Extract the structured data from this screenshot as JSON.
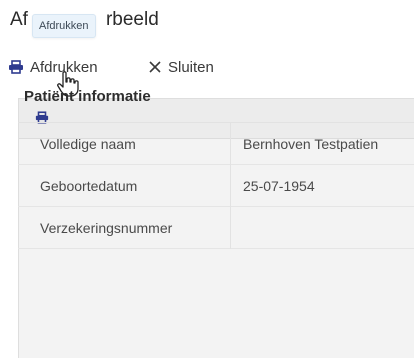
{
  "window": {
    "title_visible": "Af",
    "title_tail": "rbeeld"
  },
  "tooltip": {
    "text": "Afdrukken"
  },
  "toolbar": {
    "print_label": "Afdrukken",
    "print_icon": "printer-icon",
    "close_label": "Sluiten",
    "close_icon": "close-icon"
  },
  "panel": {
    "header_icon": "printer-icon",
    "section_title": "Patiënt informatie",
    "fields": [
      {
        "label": "Volledige naam",
        "value": "Bernhoven Testpatien"
      },
      {
        "label": "Geboortedatum",
        "value": "25-07-1954"
      },
      {
        "label": "Verzekeringsnummer",
        "value": ""
      }
    ]
  }
}
